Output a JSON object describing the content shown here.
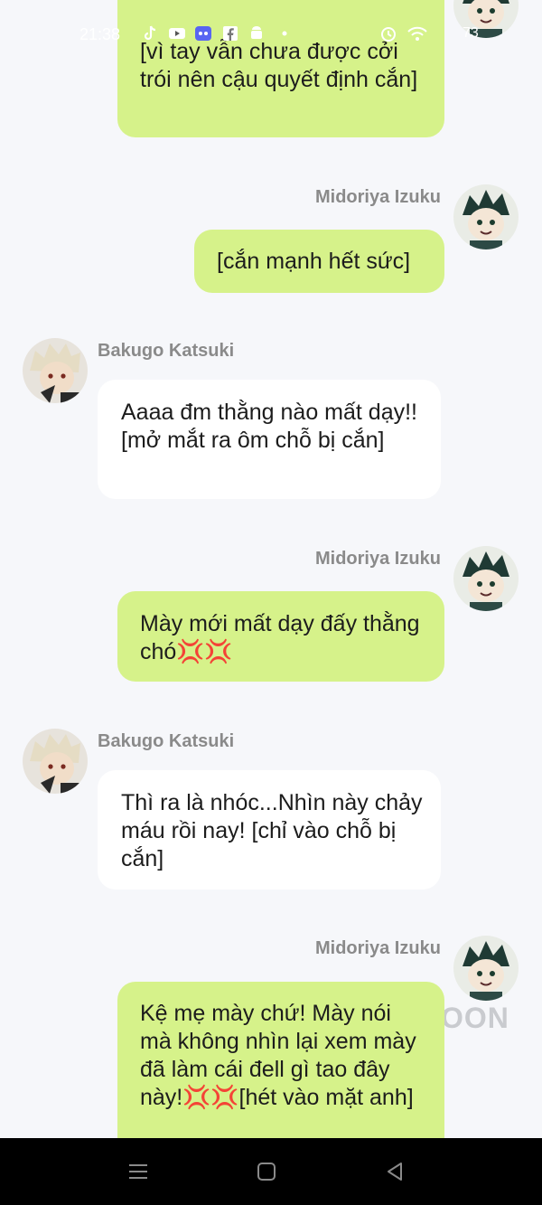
{
  "status": {
    "time": "21:38",
    "battery": "73"
  },
  "names": {
    "midoriya": "Midoriya Izuku",
    "bakugo": "Bakugo Katsuki"
  },
  "messages": [
    "[vì tay vẫn chưa được cởi trói nên cậu quyết định cắn]",
    "[cắn mạnh hết sức]",
    "Aaaa đm thằng nào mất dạy!! [mở mắt ra ôm chỗ bị cắn]",
    "Mày mới mất dạy đấy thằng chó💢💢",
    "Thì ra là nhóc...Nhìn này chảy máu rồi nay! [chỉ vào chỗ bị cắn]",
    "Kệ mẹ mày chứ! Mày nói mà không nhìn lại xem mày đã làm cái đell gì tao đây này!💢💢[hét vào mặt anh]"
  ],
  "watermark": "OON",
  "colors": {
    "background": "#f6f7fa",
    "sent_bubble": "#d6f28a",
    "received_bubble": "#ffffff",
    "name_text": "#8a8a8a"
  },
  "icons": [
    "tiktok-icon",
    "youtube-icon",
    "discord-icon",
    "facebook-icon",
    "android-icon",
    "alarm-icon",
    "wifi-icon",
    "battery-icon",
    "menu-icon",
    "home-icon",
    "back-icon"
  ]
}
